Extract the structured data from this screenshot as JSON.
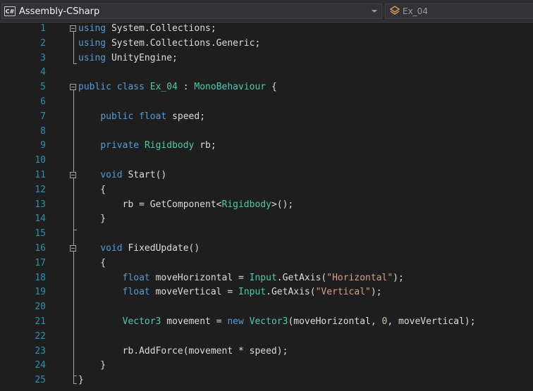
{
  "navbar": {
    "project_icon": "C#",
    "project_label": "Assembly-CSharp",
    "type_label": "Ex_04"
  },
  "colors": {
    "keyword": "#569cd6",
    "type": "#4ec9b0",
    "string": "#d69d85",
    "number": "#b5cea8",
    "line_number": "#2b91af",
    "background": "#1e1e1e"
  },
  "editor": {
    "lines": [
      {
        "n": "1",
        "tokens": [
          {
            "t": "using",
            "c": "keyword"
          },
          {
            "t": " System.Collections;",
            "c": "plain"
          }
        ]
      },
      {
        "n": "2",
        "tokens": [
          {
            "t": "using",
            "c": "keyword"
          },
          {
            "t": " System.Collections.Generic;",
            "c": "plain"
          }
        ]
      },
      {
        "n": "3",
        "tokens": [
          {
            "t": "using",
            "c": "keyword"
          },
          {
            "t": " UnityEngine;",
            "c": "plain"
          }
        ]
      },
      {
        "n": "4",
        "tokens": []
      },
      {
        "n": "5",
        "tokens": [
          {
            "t": "public",
            "c": "keyword"
          },
          {
            "t": " ",
            "c": "plain"
          },
          {
            "t": "class",
            "c": "keyword"
          },
          {
            "t": " ",
            "c": "plain"
          },
          {
            "t": "Ex_04",
            "c": "type"
          },
          {
            "t": " : ",
            "c": "plain"
          },
          {
            "t": "MonoBehaviour",
            "c": "type"
          },
          {
            "t": " {",
            "c": "plain"
          }
        ]
      },
      {
        "n": "6",
        "tokens": []
      },
      {
        "n": "7",
        "tokens": [
          {
            "t": "    ",
            "c": "plain"
          },
          {
            "t": "public",
            "c": "keyword"
          },
          {
            "t": " ",
            "c": "plain"
          },
          {
            "t": "float",
            "c": "keyword"
          },
          {
            "t": " speed;",
            "c": "plain"
          }
        ]
      },
      {
        "n": "8",
        "tokens": []
      },
      {
        "n": "9",
        "tokens": [
          {
            "t": "    ",
            "c": "plain"
          },
          {
            "t": "private",
            "c": "keyword"
          },
          {
            "t": " ",
            "c": "plain"
          },
          {
            "t": "Rigidbody",
            "c": "type"
          },
          {
            "t": " rb;",
            "c": "plain"
          }
        ]
      },
      {
        "n": "10",
        "tokens": []
      },
      {
        "n": "11",
        "tokens": [
          {
            "t": "    ",
            "c": "plain"
          },
          {
            "t": "void",
            "c": "keyword"
          },
          {
            "t": " Start()",
            "c": "plain"
          }
        ]
      },
      {
        "n": "12",
        "tokens": [
          {
            "t": "    {",
            "c": "plain"
          }
        ]
      },
      {
        "n": "13",
        "tokens": [
          {
            "t": "        rb = GetComponent<",
            "c": "plain"
          },
          {
            "t": "Rigidbody",
            "c": "type"
          },
          {
            "t": ">();",
            "c": "plain"
          }
        ]
      },
      {
        "n": "14",
        "tokens": [
          {
            "t": "    }",
            "c": "plain"
          }
        ]
      },
      {
        "n": "15",
        "tokens": []
      },
      {
        "n": "16",
        "tokens": [
          {
            "t": "    ",
            "c": "plain"
          },
          {
            "t": "void",
            "c": "keyword"
          },
          {
            "t": " FixedUpdate()",
            "c": "plain"
          }
        ]
      },
      {
        "n": "17",
        "tokens": [
          {
            "t": "    {",
            "c": "plain"
          }
        ]
      },
      {
        "n": "18",
        "tokens": [
          {
            "t": "        ",
            "c": "plain"
          },
          {
            "t": "float",
            "c": "keyword"
          },
          {
            "t": " moveHorizontal = ",
            "c": "plain"
          },
          {
            "t": "Input",
            "c": "type"
          },
          {
            "t": ".GetAxis(",
            "c": "plain"
          },
          {
            "t": "\"Horizontal\"",
            "c": "string"
          },
          {
            "t": ");",
            "c": "plain"
          }
        ]
      },
      {
        "n": "19",
        "tokens": [
          {
            "t": "        ",
            "c": "plain"
          },
          {
            "t": "float",
            "c": "keyword"
          },
          {
            "t": " moveVertical = ",
            "c": "plain"
          },
          {
            "t": "Input",
            "c": "type"
          },
          {
            "t": ".GetAxis(",
            "c": "plain"
          },
          {
            "t": "\"Vertical\"",
            "c": "string"
          },
          {
            "t": ");",
            "c": "plain"
          }
        ]
      },
      {
        "n": "20",
        "tokens": []
      },
      {
        "n": "21",
        "tokens": [
          {
            "t": "        ",
            "c": "plain"
          },
          {
            "t": "Vector3",
            "c": "type"
          },
          {
            "t": " movement = ",
            "c": "plain"
          },
          {
            "t": "new",
            "c": "keyword"
          },
          {
            "t": " ",
            "c": "plain"
          },
          {
            "t": "Vector3",
            "c": "type"
          },
          {
            "t": "(moveHorizontal, ",
            "c": "plain"
          },
          {
            "t": "0",
            "c": "number"
          },
          {
            "t": ", moveVertical);",
            "c": "plain"
          }
        ]
      },
      {
        "n": "22",
        "tokens": []
      },
      {
        "n": "23",
        "tokens": [
          {
            "t": "        rb.AddForce(movement * speed);",
            "c": "plain"
          }
        ]
      },
      {
        "n": "24",
        "tokens": [
          {
            "t": "    }",
            "c": "plain"
          }
        ]
      },
      {
        "n": "25",
        "tokens": [
          {
            "t": "}",
            "c": "plain"
          }
        ]
      }
    ]
  }
}
